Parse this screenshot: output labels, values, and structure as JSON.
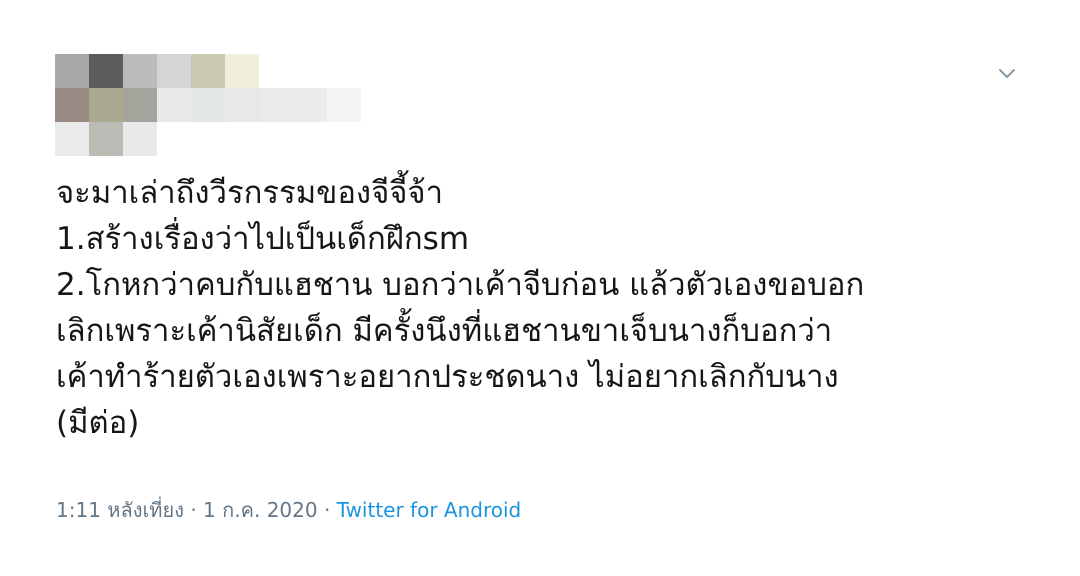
{
  "header": {
    "avatar_mosaic_colors": [
      [
        "#a8a8a8",
        "#5d5d5d",
        "#bcbcbc",
        "#d5d5d5",
        "#cbc8b0",
        "#f1eedd",
        "#ffffff",
        "#ffffff",
        "#ffffff"
      ],
      [
        "#9a8a84",
        "#a9a98f",
        "#a3a49b",
        "#e7e9ea",
        "#e2e7e7",
        "#e6e8e9",
        "#e9eaeb",
        "#eaebec",
        "#f3f4f4"
      ],
      [
        "#ebebeb",
        "#bcbcb6",
        "#e9e9e9",
        "#ffffff",
        "#ffffff",
        "#ffffff",
        "#ffffff",
        "#ffffff",
        "#ffffff"
      ]
    ],
    "menu_icon": "chevron-down-icon"
  },
  "tweet": {
    "lines": [
      "จะมาเล่าถึงวีรกรรมของจีจี้จ้า",
      "1.สร้างเรื่องว่าไปเป็นเด็กฝึกsm",
      "2.โกหกว่าคบกับแฮชาน บอกว่าเค้าจีบก่อน แล้วตัวเองขอบอก",
      "เลิกเพราะเค้านิสัยเด็ก มีครั้งนึงที่แฮชานขาเจ็บนางก็บอกว่า",
      "เค้าทำร้ายตัวเองเพราะอยากประชดนาง ไม่อยากเลิกกับนาง",
      "(มีต่อ)"
    ]
  },
  "meta": {
    "timestamp": "1:11 หลังเที่ยง · 1 ก.ค. 2020 · ",
    "source": "Twitter for Android"
  },
  "colors": {
    "text": "#14171a",
    "secondary": "#657786",
    "link": "#1b95e0"
  }
}
